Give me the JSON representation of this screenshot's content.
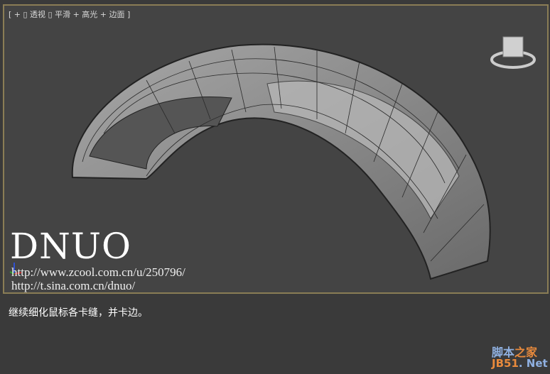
{
  "viewport": {
    "label": "[ + ▯ 透视 ▯ 平滑 + 高光 + 边面 ]"
  },
  "overlay": {
    "logo": "DNUO",
    "url1": "http://www.zcool.com.cn/u/250796/",
    "url2": "http://t.sina.com.cn/dnuo/"
  },
  "caption": "继续细化鼠标各卡缝，并卡边。",
  "watermark": {
    "line1a": "脚本",
    "line1b": "之家",
    "line2a": "JB51",
    "line2b": ". Net"
  },
  "colors": {
    "frame": "#8a7d55",
    "viewport_bg": "#444444",
    "mesh": "#8c8c8c"
  }
}
